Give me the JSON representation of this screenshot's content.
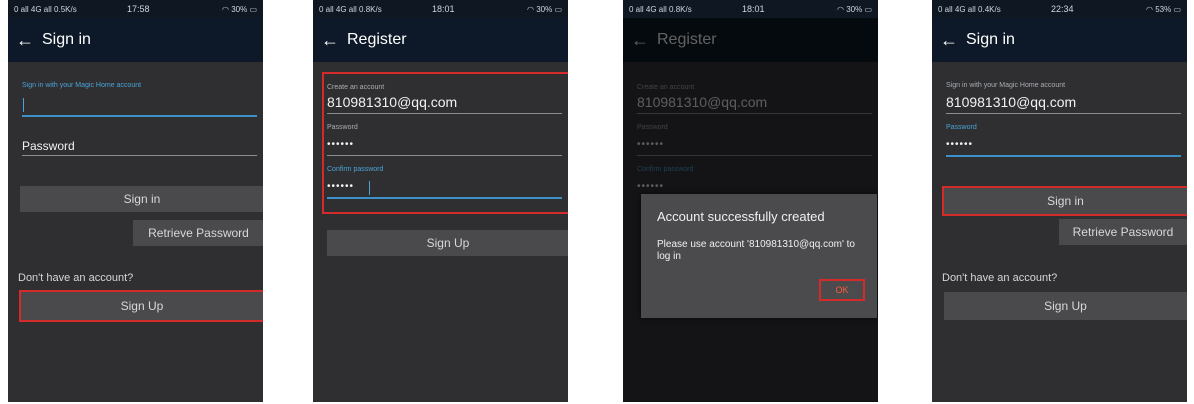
{
  "screens": [
    {
      "status": {
        "left": "0 all 4G all 0.5K/s",
        "time": "17:58",
        "right": "30%"
      },
      "title": "Sign in",
      "account_hint": "Sign in with your Magic Home account",
      "password_placeholder": "Password",
      "signin_label": "Sign in",
      "retrieve_label": "Retrieve Password",
      "no_account_text": "Don't have an account?",
      "signup_label": "Sign Up"
    },
    {
      "status": {
        "left": "0 all 4G all 0.8K/s",
        "time": "18:01",
        "right": "30%"
      },
      "title": "Register",
      "create_label": "Create an account",
      "email_value": "810981310@qq.com",
      "password_label": "Password",
      "password_value": "••••••",
      "confirm_label": "Confirm password",
      "confirm_value": "••••••",
      "signup_label": "Sign Up"
    },
    {
      "status": {
        "left": "0 all 4G all 0.8K/s",
        "time": "18:01",
        "right": "30%"
      },
      "title": "Register",
      "create_label": "Create an account",
      "email_value": "810981310@qq.com",
      "password_label": "Password",
      "password_value": "••••••",
      "confirm_label": "Confirm password",
      "confirm_value": "••••••",
      "dialog_title": "Account successfully created",
      "dialog_message": "Please use account '810981310@qq.com' to log in",
      "dialog_ok": "OK"
    },
    {
      "status": {
        "left": "0 all 4G all 0.4K/s",
        "time": "22:34",
        "right": "53%"
      },
      "title": "Sign in",
      "account_hint": "Sign in with your Magic Home account",
      "email_value": "810981310@qq.com",
      "password_label": "Password",
      "password_value": "••••••",
      "signin_label": "Sign in",
      "retrieve_label": "Retrieve Password",
      "no_account_text": "Don't have an account?",
      "signup_label": "Sign Up"
    }
  ],
  "colors": {
    "highlight": "#d42a2a",
    "accent": "#4aa3d8",
    "background": "#2f2f31",
    "topbar": "#0d1928"
  },
  "icons": {
    "back": "arrow-left-icon",
    "battery": "battery-icon",
    "wifi": "wifi-icon"
  }
}
